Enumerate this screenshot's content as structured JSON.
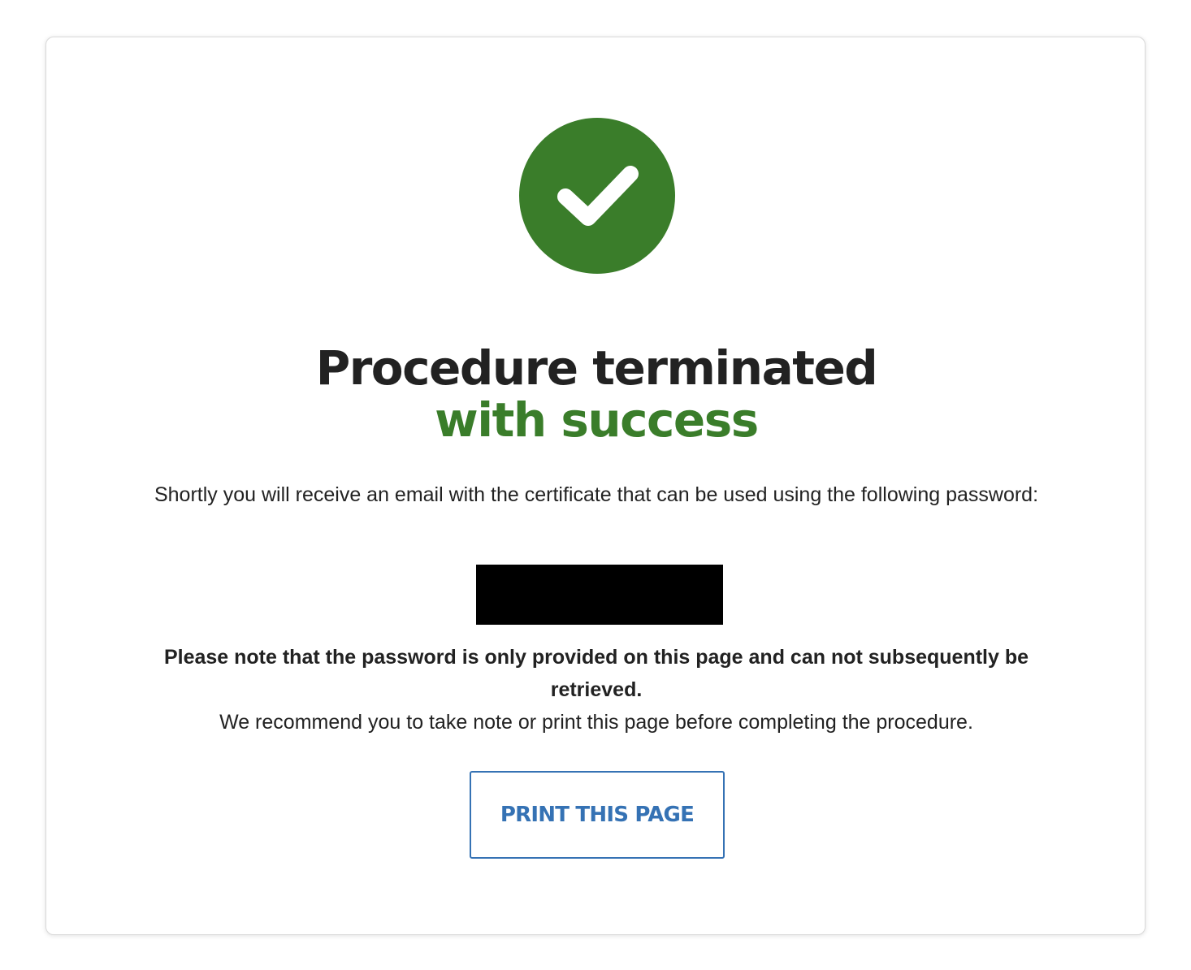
{
  "colors": {
    "success_green": "#3a7d2a",
    "primary_blue": "#3572b4",
    "text": "#222222",
    "password_redaction": "#000000"
  },
  "icon": "checkmark-circle-icon",
  "title": {
    "line1": "Procedure terminated",
    "line2": "with success"
  },
  "message": "Shortly you will receive an email with the certificate that can be used using the following password:",
  "password": "",
  "note": {
    "bold": "Please note that the password is only provided on this page and can not subsequently be retrieved.",
    "regular": "We recommend you to take note or print this page before completing the procedure."
  },
  "print_button_label": "PRINT THIS PAGE"
}
